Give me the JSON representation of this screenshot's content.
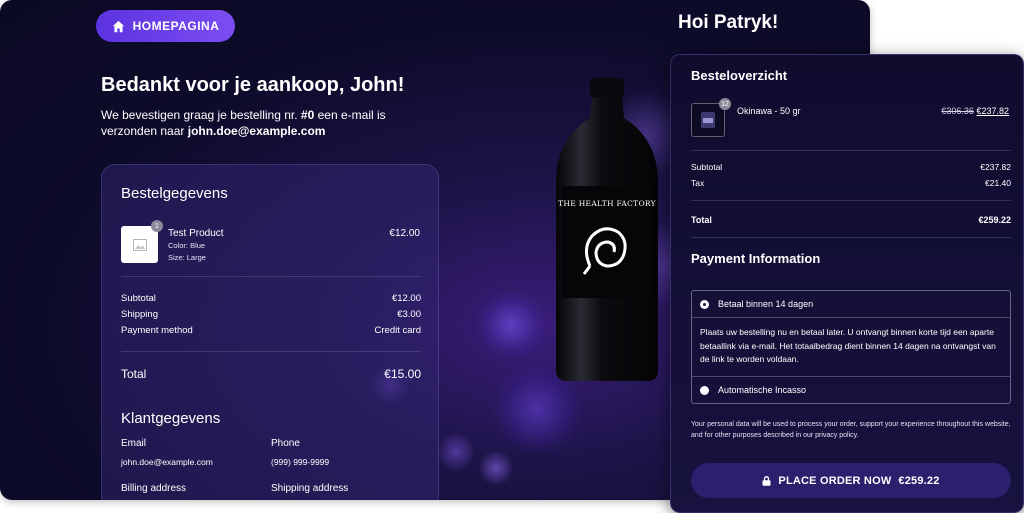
{
  "header": {
    "home_button_label": "HOMEPAGINA",
    "greeting": "Hoi Patryk!"
  },
  "confirmation": {
    "title": "Bedankt voor je aankoop, John!",
    "line_pre": "We bevestigen graag je bestelling nr.",
    "order_number": "#0",
    "line_mid": "een e-mail is verzonden naar",
    "email": "john.doe@example.com"
  },
  "order_details": {
    "heading": "Bestelgegevens",
    "item": {
      "quantity": "1",
      "name": "Test Product",
      "color": "Color: Blue",
      "size": "Size: Large",
      "price": "€12.00"
    },
    "subtotal_label": "Subtotal",
    "subtotal_value": "€12.00",
    "shipping_label": "Shipping",
    "shipping_value": "€3.00",
    "payment_method_label": "Payment method",
    "payment_method_value": "Credit card",
    "total_label": "Total",
    "total_value": "€15.00"
  },
  "customer": {
    "heading": "Klantgegevens",
    "email_label": "Email",
    "email_value": "john.doe@example.com",
    "phone_label": "Phone",
    "phone_value": "(999) 999-9999",
    "billing_label": "Billing address",
    "shipping_label": "Shipping address"
  },
  "bottle": {
    "brand_text": "THE HEALTH FACTORY"
  },
  "summary": {
    "title": "Besteloverzicht",
    "item": {
      "quantity": "12",
      "name": "Okinawa - 50 gr",
      "old_price": "€306.36",
      "new_price": "€237.82"
    },
    "subtotal_label": "Subtotal",
    "subtotal_value": "€237.82",
    "tax_label": "Tax",
    "tax_value": "€21.40",
    "total_label": "Total",
    "total_value": "€259.22"
  },
  "payment": {
    "title": "Payment Information",
    "option_1": "Betaal binnen 14 dagen",
    "option_1_description": "Plaats uw bestelling nu en betaal later. U ontvangt binnen korte tijd een aparte betaallink via e-mail. Het totaalbedrag dient binnen 14 dagen na ontvangst van de link te worden voldaan.",
    "option_2": "Automatische Incasso",
    "privacy_text": "Your personal data will be used to process your order, support your experience throughout this website, and for other purposes described in our privacy policy.",
    "place_order_label": "PLACE ORDER NOW",
    "place_order_amount": "€259.22"
  },
  "colors": {
    "accent": "#6a3ef0",
    "background": "#0d0b2a",
    "button_dark": "#2b1f6e"
  },
  "icons": [
    "home-icon",
    "image-placeholder-icon",
    "lock-icon"
  ]
}
